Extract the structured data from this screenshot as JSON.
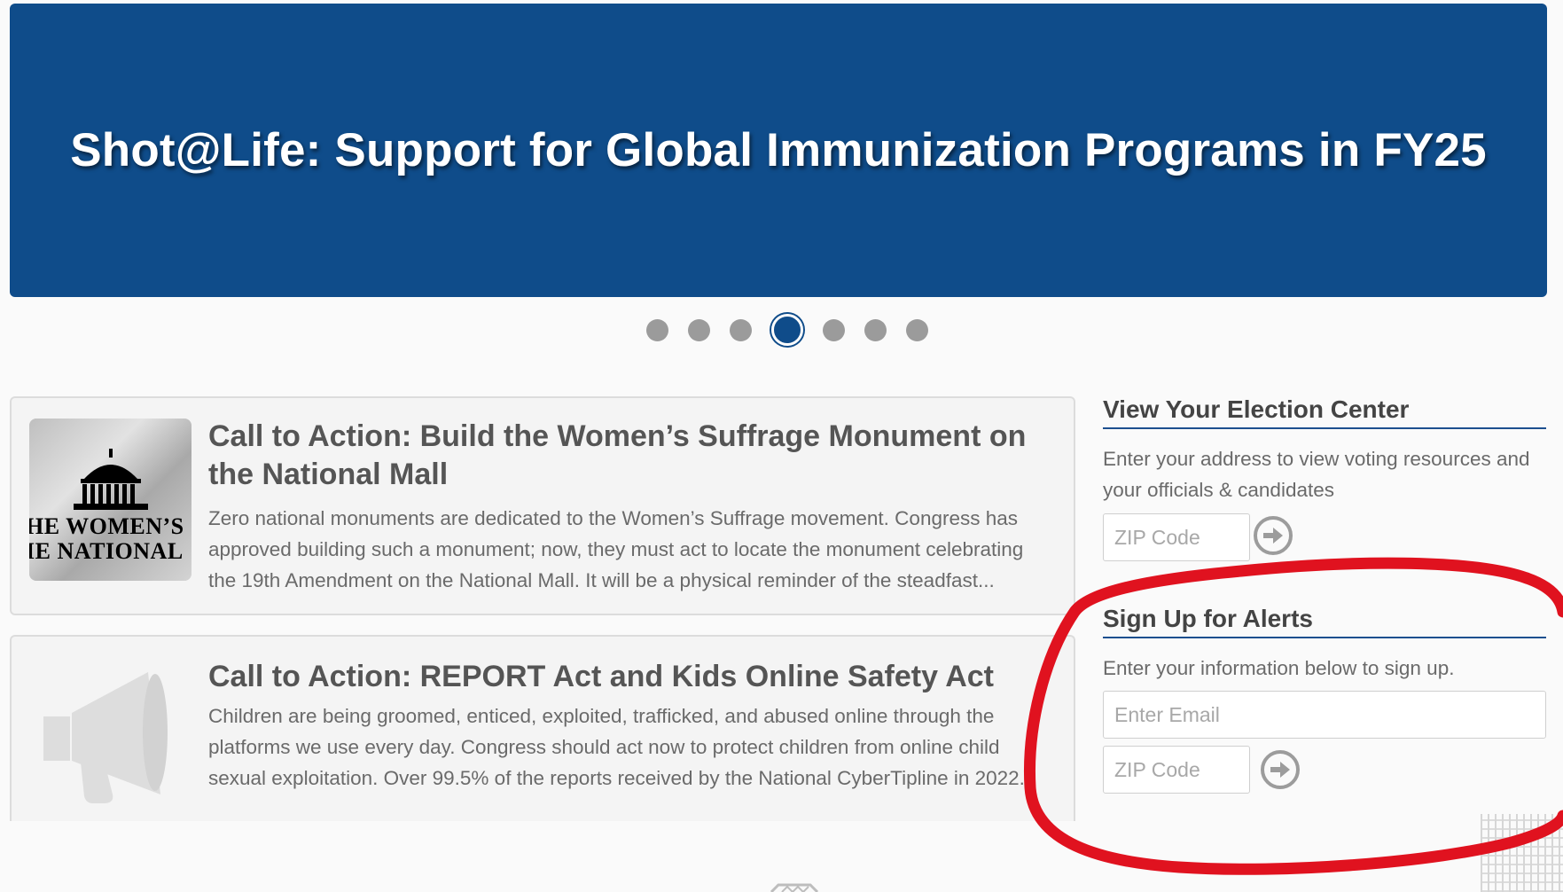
{
  "hero": {
    "title": "Shot@Life: Support for Global Immunization Programs in FY25",
    "background": "#0f4c8a"
  },
  "carousel": {
    "slide_count": 7,
    "active_index": 3
  },
  "actions": [
    {
      "title": "Call to Action: Build the Women’s Suffrage Monument on the National Mall",
      "description": "Zero national monuments are dedicated to the Women’s Suffrage movement. Congress has approved building such a monument; now, they must act to locate the monument celebrating the 19th Amendment on the National Mall.  It will be a physical reminder of the steadfast...",
      "thumb_line1": "HE WOMEN’S",
      "thumb_line2": "IE NATIONAL",
      "thumb_icon": "capitol-dome-icon"
    },
    {
      "title": "Call to Action: REPORT Act and Kids Online Safety Act",
      "description": "Children are being groomed, enticed, exploited, trafficked, and abused online through the platforms we use every day. Congress should act now to protect children from online child sexual exploitation. Over 99.5% of the reports received by the National CyberTipline in 2022...",
      "thumb_icon": "megaphone-icon"
    }
  ],
  "election_center": {
    "title": "View Your Election Center",
    "description": "Enter your address to view voting resources and your officials & candidates",
    "zip_placeholder": "ZIP Code",
    "go_icon": "arrow-right-circle-icon"
  },
  "alerts": {
    "title": "Sign Up for Alerts",
    "description": "Enter your information below to sign up.",
    "email_placeholder": "Enter Email",
    "zip_placeholder": "ZIP Code",
    "go_icon": "arrow-right-circle-icon"
  },
  "colors": {
    "brand_blue": "#0f4c8a",
    "annotation_red": "#e0121f"
  }
}
